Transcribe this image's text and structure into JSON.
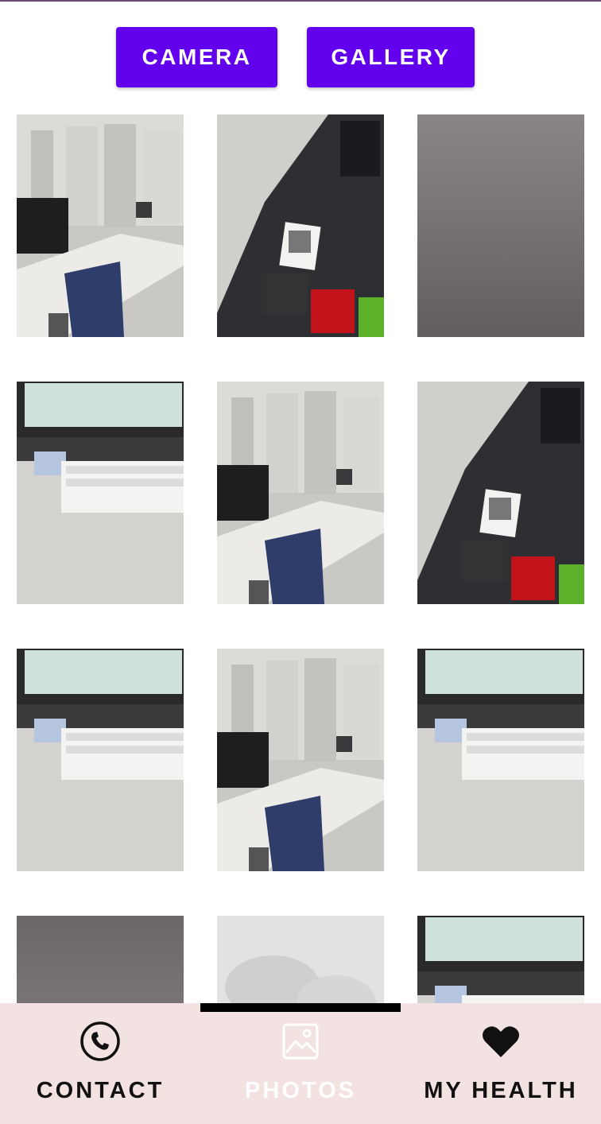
{
  "buttons": {
    "camera": "CAMERA",
    "gallery": "GALLERY"
  },
  "gallery": {
    "photos": [
      "office-room",
      "laptop-stickers",
      "gray-blank",
      "desk-keyboard",
      "office-room",
      "laptop-stickers",
      "desk-keyboard",
      "office-room",
      "desk-keyboard",
      "gray-blank",
      "blurry-white",
      "desk-keyboard"
    ]
  },
  "bottom_nav": {
    "items": [
      {
        "label": "CONTACT",
        "icon": "phone-icon",
        "selected": false
      },
      {
        "label": "PHOTOS",
        "icon": "image-icon",
        "selected": true
      },
      {
        "label": "MY HEALTH",
        "icon": "heart-icon",
        "selected": false
      }
    ]
  },
  "colors": {
    "primary": "#6200ee",
    "nav_background": "#f3e2e2",
    "indicator": "#000000"
  }
}
